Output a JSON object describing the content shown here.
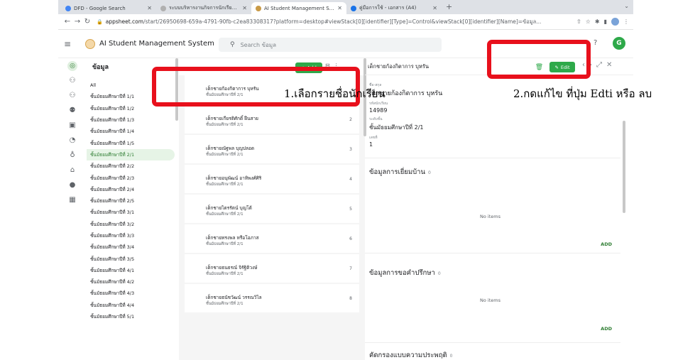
{
  "browser": {
    "tabs": [
      {
        "title": "DFD - Google Search",
        "color": "#4285f4"
      },
      {
        "title": "ระบบบริหารงานกิจการนักเรียน อง",
        "color": "#b0b0b0"
      },
      {
        "title": "AI Student Management Syste",
        "color": "#c99a47",
        "active": true
      },
      {
        "title": "คู่มือการใช้ - เอกสาร (A4)",
        "color": "#1a73e8"
      }
    ],
    "new_tab": "+",
    "url_host": "appsheet.com",
    "url_path": "/start/26950698-659a-4791-90fb-c2ea83308317?platform=desktop#viewStack[0][identifier][Type]=Control&viewStack[0][identifier][Name]=ข้อมูล..."
  },
  "app": {
    "name": "AI Student Management System",
    "search_placeholder": "Search ข้อมูล",
    "avatar_letter": "G",
    "accent": "#2ea94a"
  },
  "category_panel": {
    "title": "ข้อมูล",
    "items": [
      "All",
      "ชั้นมัธยมศึกษาปีที่ 1/1",
      "ชั้นมัธยมศึกษาปีที่ 1/2",
      "ชั้นมัธยมศึกษาปีที่ 1/3",
      "ชั้นมัธยมศึกษาปีที่ 1/4",
      "ชั้นมัธยมศึกษาปีที่ 1/5",
      "ชั้นมัธยมศึกษาปีที่ 2/1",
      "ชั้นมัธยมศึกษาปีที่ 2/2",
      "ชั้นมัธยมศึกษาปีที่ 2/3",
      "ชั้นมัธยมศึกษาปีที่ 2/4",
      "ชั้นมัธยมศึกษาปีที่ 2/5",
      "ชั้นมัธยมศึกษาปีที่ 3/1",
      "ชั้นมัธยมศึกษาปีที่ 3/2",
      "ชั้นมัธยมศึกษาปีที่ 3/3",
      "ชั้นมัธยมศึกษาปีที่ 3/4",
      "ชั้นมัธยมศึกษาปีที่ 3/5",
      "ชั้นมัธยมศึกษาปีที่ 4/1",
      "ชั้นมัธยมศึกษาปีที่ 4/2",
      "ชั้นมัธยมศึกษาปีที่ 4/3",
      "ชั้นมัธยมศึกษาปีที่ 4/4",
      "ชั้นมัธยมศึกษาปีที่ 5/1"
    ],
    "selected_index": 6
  },
  "list_panel": {
    "add_label": "+ Add",
    "rows": [
      {
        "name": "เด็กชายก้องกิตาการ บุหรัน",
        "class": "ชั้นมัธยมศึกษาปีที่ 2/1",
        "num": ""
      },
      {
        "name": "เด็กชายเกียรติศักดิ์ ฝืนสาย",
        "class": "ชั้นมัธยมศึกษาปีที่ 2/1",
        "num": "2"
      },
      {
        "name": "เด็กชายณัฐพล บุญปลอด",
        "class": "ชั้นมัธยมศึกษาปีที่ 2/1",
        "num": "3"
      },
      {
        "name": "เด็กชายอนุพัฒน์ อาทิพงศ์ศิริ",
        "class": "ชั้นมัธยมศึกษาปีที่ 2/1",
        "num": "4"
      },
      {
        "name": "เด็กชายไตรรัตน์ บุญโต้",
        "class": "ชั้นมัธยมศึกษาปีที่ 2/1",
        "num": "5"
      },
      {
        "name": "เด็กชายทรงพล หรือโอภาส",
        "class": "ชั้นมัธยมศึกษาปีที่ 2/1",
        "num": "6"
      },
      {
        "name": "เด็กชายธนธรณ์ จิรัฐิติวงษ์",
        "class": "ชั้นมัธยมศึกษาปีที่ 2/1",
        "num": "7"
      },
      {
        "name": "เด็กชายธนัชวัฒน์ วรรณวิไล",
        "class": "ชั้นมัธยมศึกษาปีที่ 2/1",
        "num": "8"
      }
    ]
  },
  "detail": {
    "title": "เด็กชายก้องกิตาการ บุหรัน",
    "edit_label": "Edit",
    "fields": [
      {
        "label": "ชื่อ-สกุล",
        "value": "เด็กชายก้องกิตาการ บุหรัน"
      },
      {
        "label": "รหัสนักเรียน",
        "value": "14989"
      },
      {
        "label": "ระดับชั้น",
        "value": "ชั้นมัธยมศึกษาปีที่ 2/1"
      },
      {
        "label": "เลขที่",
        "value": "1"
      }
    ],
    "sections": [
      {
        "title": "ข้อมูลการเยี่ยมบ้าน",
        "count": "0",
        "empty": "No items",
        "add": "ADD"
      },
      {
        "title": "ข้อมูลการขอคำปรึกษา",
        "count": "0",
        "empty": "No items",
        "add": "ADD"
      },
      {
        "title": "คัดกรองแบบความประพฤติ",
        "count": "0"
      }
    ]
  },
  "annotations": {
    "step1": "1.เลือกรายชื่อนักเรียน",
    "step2": "2.กดแก้ไข ที่ปุ่ม Edti หรือ ลบ",
    "color": "#e8101c"
  }
}
